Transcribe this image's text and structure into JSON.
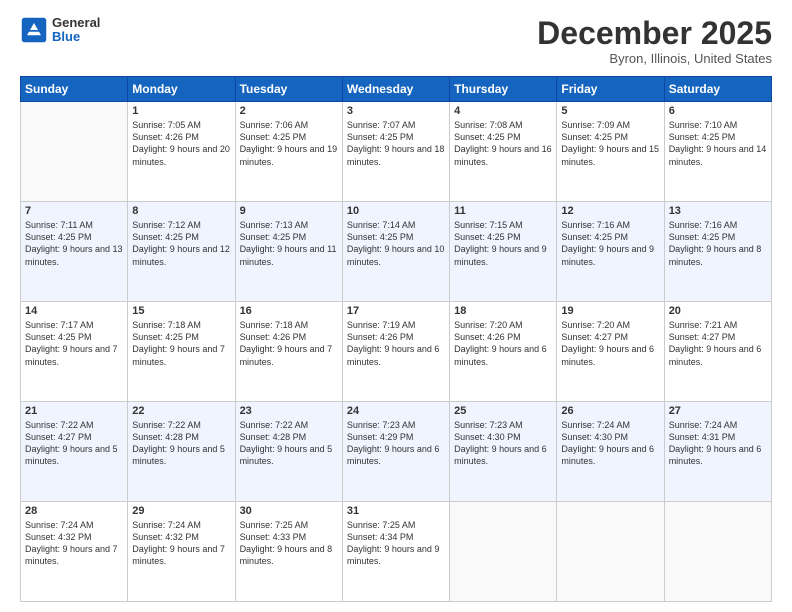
{
  "header": {
    "logo": {
      "general": "General",
      "blue": "Blue"
    },
    "month": "December 2025",
    "location": "Byron, Illinois, United States"
  },
  "days": [
    "Sunday",
    "Monday",
    "Tuesday",
    "Wednesday",
    "Thursday",
    "Friday",
    "Saturday"
  ],
  "rows": [
    [
      {
        "day": "",
        "sunrise": "",
        "sunset": "",
        "daylight": ""
      },
      {
        "day": "1",
        "sunrise": "Sunrise: 7:05 AM",
        "sunset": "Sunset: 4:26 PM",
        "daylight": "Daylight: 9 hours and 20 minutes."
      },
      {
        "day": "2",
        "sunrise": "Sunrise: 7:06 AM",
        "sunset": "Sunset: 4:25 PM",
        "daylight": "Daylight: 9 hours and 19 minutes."
      },
      {
        "day": "3",
        "sunrise": "Sunrise: 7:07 AM",
        "sunset": "Sunset: 4:25 PM",
        "daylight": "Daylight: 9 hours and 18 minutes."
      },
      {
        "day": "4",
        "sunrise": "Sunrise: 7:08 AM",
        "sunset": "Sunset: 4:25 PM",
        "daylight": "Daylight: 9 hours and 16 minutes."
      },
      {
        "day": "5",
        "sunrise": "Sunrise: 7:09 AM",
        "sunset": "Sunset: 4:25 PM",
        "daylight": "Daylight: 9 hours and 15 minutes."
      },
      {
        "day": "6",
        "sunrise": "Sunrise: 7:10 AM",
        "sunset": "Sunset: 4:25 PM",
        "daylight": "Daylight: 9 hours and 14 minutes."
      }
    ],
    [
      {
        "day": "7",
        "sunrise": "Sunrise: 7:11 AM",
        "sunset": "Sunset: 4:25 PM",
        "daylight": "Daylight: 9 hours and 13 minutes."
      },
      {
        "day": "8",
        "sunrise": "Sunrise: 7:12 AM",
        "sunset": "Sunset: 4:25 PM",
        "daylight": "Daylight: 9 hours and 12 minutes."
      },
      {
        "day": "9",
        "sunrise": "Sunrise: 7:13 AM",
        "sunset": "Sunset: 4:25 PM",
        "daylight": "Daylight: 9 hours and 11 minutes."
      },
      {
        "day": "10",
        "sunrise": "Sunrise: 7:14 AM",
        "sunset": "Sunset: 4:25 PM",
        "daylight": "Daylight: 9 hours and 10 minutes."
      },
      {
        "day": "11",
        "sunrise": "Sunrise: 7:15 AM",
        "sunset": "Sunset: 4:25 PM",
        "daylight": "Daylight: 9 hours and 9 minutes."
      },
      {
        "day": "12",
        "sunrise": "Sunrise: 7:16 AM",
        "sunset": "Sunset: 4:25 PM",
        "daylight": "Daylight: 9 hours and 9 minutes."
      },
      {
        "day": "13",
        "sunrise": "Sunrise: 7:16 AM",
        "sunset": "Sunset: 4:25 PM",
        "daylight": "Daylight: 9 hours and 8 minutes."
      }
    ],
    [
      {
        "day": "14",
        "sunrise": "Sunrise: 7:17 AM",
        "sunset": "Sunset: 4:25 PM",
        "daylight": "Daylight: 9 hours and 7 minutes."
      },
      {
        "day": "15",
        "sunrise": "Sunrise: 7:18 AM",
        "sunset": "Sunset: 4:25 PM",
        "daylight": "Daylight: 9 hours and 7 minutes."
      },
      {
        "day": "16",
        "sunrise": "Sunrise: 7:18 AM",
        "sunset": "Sunset: 4:26 PM",
        "daylight": "Daylight: 9 hours and 7 minutes."
      },
      {
        "day": "17",
        "sunrise": "Sunrise: 7:19 AM",
        "sunset": "Sunset: 4:26 PM",
        "daylight": "Daylight: 9 hours and 6 minutes."
      },
      {
        "day": "18",
        "sunrise": "Sunrise: 7:20 AM",
        "sunset": "Sunset: 4:26 PM",
        "daylight": "Daylight: 9 hours and 6 minutes."
      },
      {
        "day": "19",
        "sunrise": "Sunrise: 7:20 AM",
        "sunset": "Sunset: 4:27 PM",
        "daylight": "Daylight: 9 hours and 6 minutes."
      },
      {
        "day": "20",
        "sunrise": "Sunrise: 7:21 AM",
        "sunset": "Sunset: 4:27 PM",
        "daylight": "Daylight: 9 hours and 6 minutes."
      }
    ],
    [
      {
        "day": "21",
        "sunrise": "Sunrise: 7:22 AM",
        "sunset": "Sunset: 4:27 PM",
        "daylight": "Daylight: 9 hours and 5 minutes."
      },
      {
        "day": "22",
        "sunrise": "Sunrise: 7:22 AM",
        "sunset": "Sunset: 4:28 PM",
        "daylight": "Daylight: 9 hours and 5 minutes."
      },
      {
        "day": "23",
        "sunrise": "Sunrise: 7:22 AM",
        "sunset": "Sunset: 4:28 PM",
        "daylight": "Daylight: 9 hours and 5 minutes."
      },
      {
        "day": "24",
        "sunrise": "Sunrise: 7:23 AM",
        "sunset": "Sunset: 4:29 PM",
        "daylight": "Daylight: 9 hours and 6 minutes."
      },
      {
        "day": "25",
        "sunrise": "Sunrise: 7:23 AM",
        "sunset": "Sunset: 4:30 PM",
        "daylight": "Daylight: 9 hours and 6 minutes."
      },
      {
        "day": "26",
        "sunrise": "Sunrise: 7:24 AM",
        "sunset": "Sunset: 4:30 PM",
        "daylight": "Daylight: 9 hours and 6 minutes."
      },
      {
        "day": "27",
        "sunrise": "Sunrise: 7:24 AM",
        "sunset": "Sunset: 4:31 PM",
        "daylight": "Daylight: 9 hours and 6 minutes."
      }
    ],
    [
      {
        "day": "28",
        "sunrise": "Sunrise: 7:24 AM",
        "sunset": "Sunset: 4:32 PM",
        "daylight": "Daylight: 9 hours and 7 minutes."
      },
      {
        "day": "29",
        "sunrise": "Sunrise: 7:24 AM",
        "sunset": "Sunset: 4:32 PM",
        "daylight": "Daylight: 9 hours and 7 minutes."
      },
      {
        "day": "30",
        "sunrise": "Sunrise: 7:25 AM",
        "sunset": "Sunset: 4:33 PM",
        "daylight": "Daylight: 9 hours and 8 minutes."
      },
      {
        "day": "31",
        "sunrise": "Sunrise: 7:25 AM",
        "sunset": "Sunset: 4:34 PM",
        "daylight": "Daylight: 9 hours and 9 minutes."
      },
      {
        "day": "",
        "sunrise": "",
        "sunset": "",
        "daylight": ""
      },
      {
        "day": "",
        "sunrise": "",
        "sunset": "",
        "daylight": ""
      },
      {
        "day": "",
        "sunrise": "",
        "sunset": "",
        "daylight": ""
      }
    ]
  ]
}
